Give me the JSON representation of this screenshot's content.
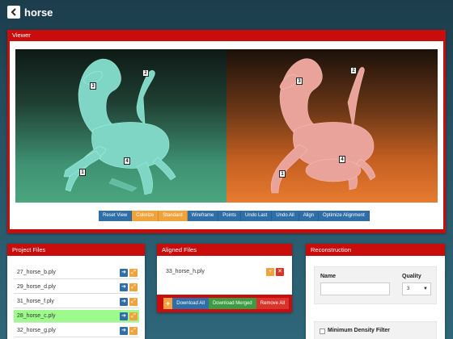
{
  "app": {
    "title": "horse"
  },
  "viewer": {
    "title": "Viewer",
    "left_markers": [
      "1",
      "2",
      "3",
      "4"
    ],
    "right_markers": [
      "1",
      "2",
      "3",
      "4"
    ],
    "colors": {
      "source_mesh": "#7fd6c5",
      "target_mesh": "#e9a39a",
      "marker_fill": "#1a1aff"
    },
    "toolbar": [
      {
        "label": "Reset View",
        "style": "blue"
      },
      {
        "label": "Colorize",
        "style": "orange"
      },
      {
        "label": "Standard",
        "style": "orange"
      },
      {
        "label": "Wireframe",
        "style": "blue"
      },
      {
        "label": "Points",
        "style": "blue"
      },
      {
        "label": "Undo Last",
        "style": "blue"
      },
      {
        "label": "Undo All",
        "style": "blue"
      },
      {
        "label": "Align",
        "style": "blue"
      },
      {
        "label": "Optimize Alignment",
        "style": "blue"
      }
    ]
  },
  "project_files": {
    "title": "Project Files",
    "files": [
      {
        "name": "27_horse_b.ply",
        "selected": false
      },
      {
        "name": "29_horse_d.ply",
        "selected": false
      },
      {
        "name": "31_horse_f.ply",
        "selected": false
      },
      {
        "name": "28_horse_c.ply",
        "selected": true
      },
      {
        "name": "32_horse_g.ply",
        "selected": false
      }
    ]
  },
  "aligned_files": {
    "title": "Aligned Files",
    "files": [
      {
        "name": "33_horse_h.ply"
      }
    ],
    "footer": {
      "add_label": "+",
      "download_all": "Download All",
      "download_merged": "Download Merged",
      "remove_all": "Remove All"
    }
  },
  "reconstruction": {
    "title": "Reconstruction",
    "name_label": "Name",
    "name_value": "",
    "quality_label": "Quality",
    "quality_value": "3",
    "filter_label": "Minimum Density Filter"
  }
}
